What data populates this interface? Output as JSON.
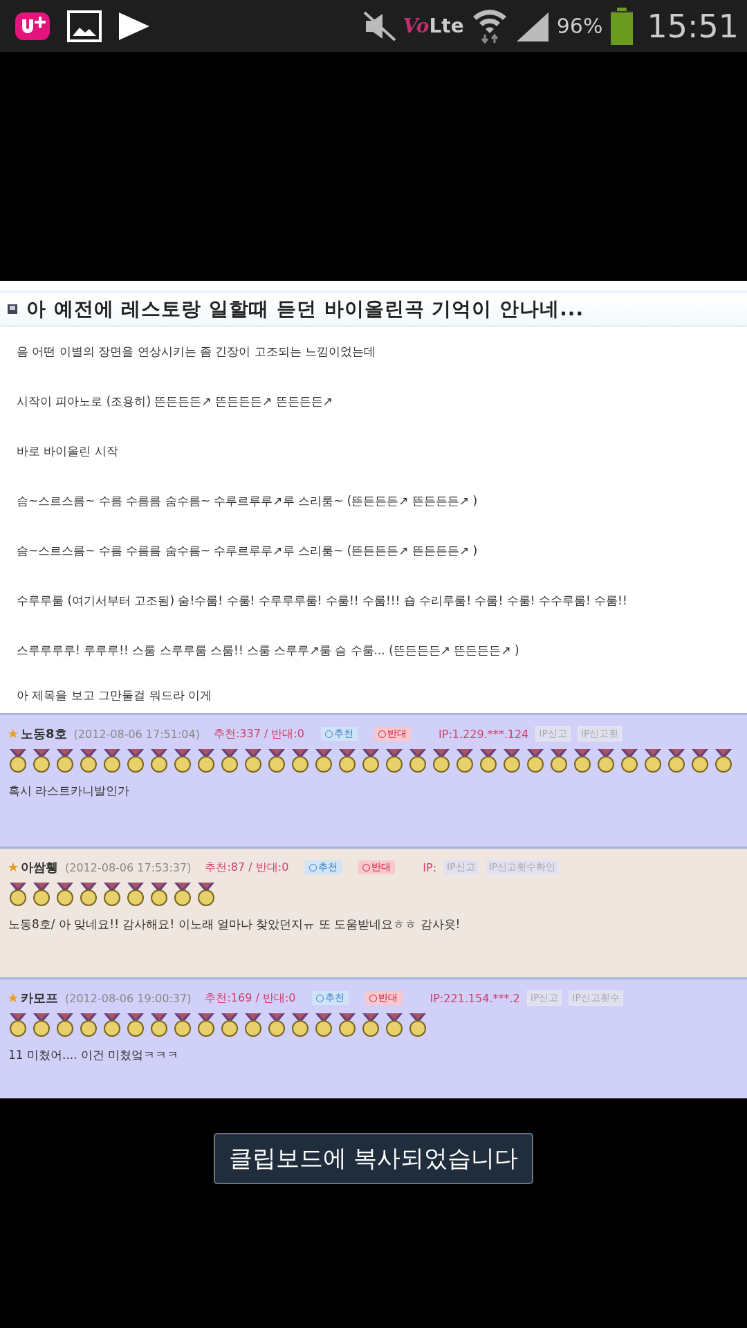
{
  "status_bar": {
    "vo": "Vo",
    "lte": "Lte",
    "battery": "96%",
    "time": "15:51"
  },
  "post": {
    "title": "아 예전에 레스토랑 일할때 듣던 바이올린곡 기억이 안나네...",
    "lines": [
      "음 어떤 이별의 장면을 연상시키는 좀 긴장이 고조되는 느낌이었는데",
      "시작이 피아노로 (조용히) 뜬든든든↗ 뜬든든든↗ 뜬든든든↗",
      "바로 바이올린 시작",
      "슴~스르스름~ 수름 수름름 숨수름~ 수루르루루↗루 스리룸~ (뜬든든든↗ 뜬든든든↗ )",
      "슴~스르스름~ 수름 수름름 숨수름~ 수루르루루↗루 스리룸~ (뜬든든든↗ 뜬든든든↗ )",
      "수루루룸 (여기서부터 고조됨) 숨!수룸! 수룸! 수루루루룸! 수룸!! 수룸!!! 숍 수리루룸! 수룸! 수룸! 수수루룸! 수룸!!",
      "스루루루루! 루루루!! 스룸 스루루룸 스룸!! 스룸 스루루↗룸 슴 수룸... (뜬든든든↗ 뜬든든든↗ )",
      "아 제목을 보고 그만둘걸 뭐드라 이게"
    ]
  },
  "comments": [
    {
      "color": "#d0d0f8",
      "name": "노동8호",
      "date": "(2012-08-06 17:51:04)",
      "votes": "추천:337 / 반대:0",
      "up": "추천",
      "down": "반대",
      "ip": "IP:1.229.***.124",
      "report": "IP신고",
      "report_count": "IP신고횟",
      "medals": [
        {
          "kind": "medal"
        },
        {
          "kind": "medal"
        },
        {
          "kind": "medal"
        },
        {
          "kind": "medal"
        },
        {
          "kind": "medal"
        },
        {
          "kind": "medal"
        },
        {
          "kind": "medal"
        },
        {
          "kind": "medal"
        },
        {
          "kind": "medal"
        },
        {
          "kind": "medal"
        },
        {
          "kind": "medal"
        },
        {
          "kind": "medal"
        },
        {
          "kind": "medal"
        },
        {
          "kind": "medal"
        },
        {
          "kind": "medal"
        },
        {
          "kind": "medal"
        },
        {
          "kind": "medal"
        },
        {
          "kind": "medal"
        },
        {
          "kind": "medal"
        },
        {
          "kind": "medal"
        },
        {
          "kind": "medal"
        },
        {
          "kind": "medal"
        },
        {
          "kind": "medal"
        },
        {
          "kind": "medal"
        },
        {
          "kind": "medal"
        },
        {
          "kind": "medal"
        },
        {
          "kind": "medal"
        },
        {
          "kind": "medal"
        },
        {
          "kind": "medal"
        },
        {
          "kind": "medal"
        },
        {
          "kind": "medal"
        }
      ],
      "text": "혹시 라스트카니발인가"
    },
    {
      "color": "#efe6e0",
      "name": "아쌈휑",
      "date": "(2012-08-06 17:53:37)",
      "votes": "추천:87 / 반대:0",
      "up": "추천",
      "down": "반대",
      "ip": "IP:",
      "report": "IP신고",
      "report_count": "IP신고횟수확인",
      "medals": [
        {
          "kind": "medal"
        },
        {
          "kind": "medal"
        },
        {
          "kind": "medal"
        },
        {
          "kind": "medal"
        },
        {
          "kind": "medal"
        },
        {
          "kind": "medal"
        },
        {
          "kind": "medal"
        },
        {
          "kind": "medal"
        },
        {
          "kind": "medal"
        }
      ],
      "text": "노동8호/ 아 맞네요!! 감사해요! 이노래 얼마나 찾았던지ㅠ 또 도움받네요ㅎㅎ 감사욧!"
    },
    {
      "color": "#d0d0f8",
      "name": "카모프",
      "date": "(2012-08-06 19:00:37)",
      "votes": "추천:169 / 반대:0",
      "up": "추천",
      "down": "반대",
      "ip": "IP:221.154.***.2",
      "report": "IP신고",
      "report_count": "IP신고횟수",
      "medals": [
        {
          "kind": "medal"
        },
        {
          "kind": "medal"
        },
        {
          "kind": "medal"
        },
        {
          "kind": "medal"
        },
        {
          "kind": "medal"
        },
        {
          "kind": "medal"
        },
        {
          "kind": "medal"
        },
        {
          "kind": "medal"
        },
        {
          "kind": "medal"
        },
        {
          "kind": "medal"
        },
        {
          "kind": "medal"
        },
        {
          "kind": "medal"
        },
        {
          "kind": "medal"
        },
        {
          "kind": "medal"
        },
        {
          "kind": "medal"
        },
        {
          "kind": "medal"
        },
        {
          "kind": "medal"
        },
        {
          "kind": "medal"
        }
      ],
      "text": "11 미쳤어.... 이건 미쳤엌ㅋㅋㅋ"
    }
  ],
  "toast": "클립보드에 복사되었습니다"
}
